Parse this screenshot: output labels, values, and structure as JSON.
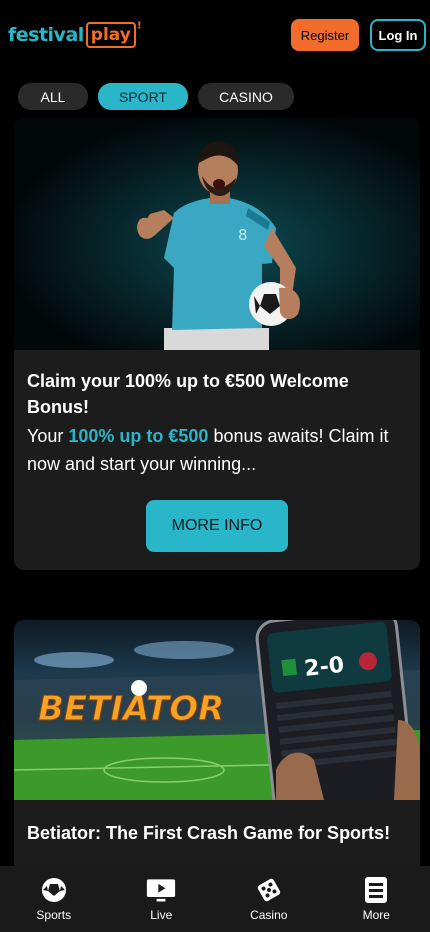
{
  "header": {
    "logo_festival": "festival",
    "logo_play": "play",
    "register_label": "Register",
    "login_label": "Log In"
  },
  "tabs": [
    {
      "label": "ALL",
      "active": false
    },
    {
      "label": "SPORT",
      "active": true
    },
    {
      "label": "CASINO",
      "active": false
    }
  ],
  "promos": [
    {
      "title": "Claim your 100% up to €500 Welcome Bonus!",
      "text_before": "Your ",
      "text_highlight": "100% up to €500",
      "text_after": " bonus awaits! Claim it now and start your winning...",
      "button_label": "MORE INFO",
      "player_number": "8"
    },
    {
      "title": "Betiator: The First Crash Game for Sports!",
      "image_brand": "BETIATOR",
      "score": "2-0"
    }
  ],
  "bottom_nav": [
    {
      "label": "Sports",
      "icon": "soccer-ball-icon"
    },
    {
      "label": "Live",
      "icon": "tv-play-icon"
    },
    {
      "label": "Casino",
      "icon": "dice-icon"
    },
    {
      "label": "More",
      "icon": "list-icon"
    }
  ],
  "colors": {
    "accent": "#29b6c8",
    "brand_orange": "#f26d2c",
    "background": "#000000",
    "card": "#1c1c1c",
    "nav": "#1a1a1a"
  }
}
